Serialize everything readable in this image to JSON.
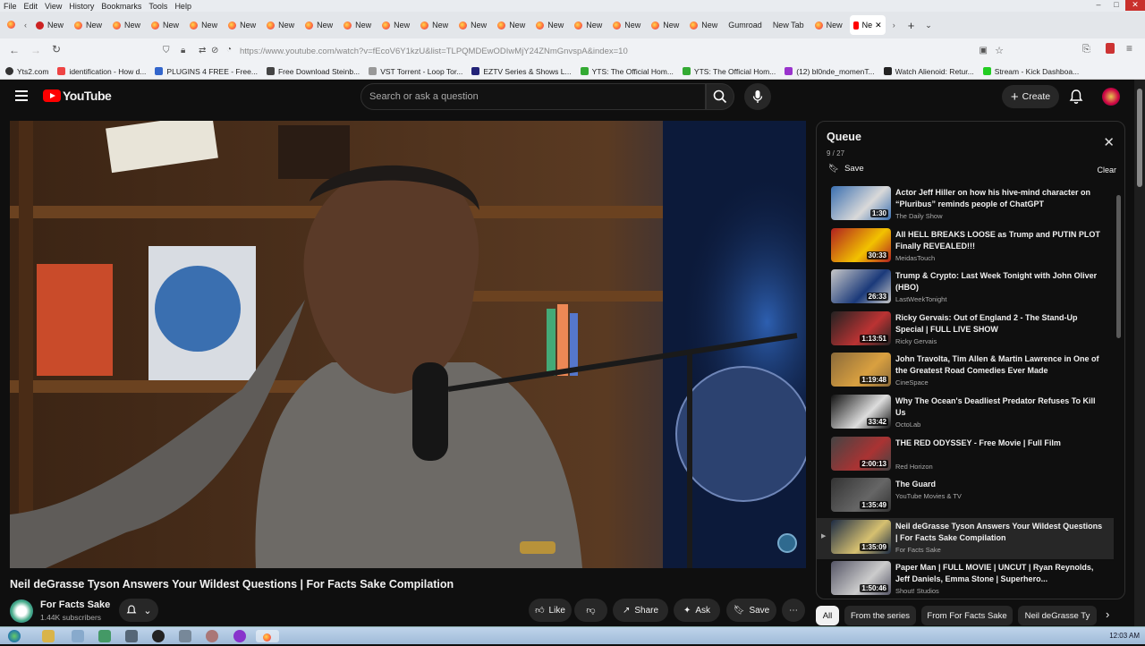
{
  "browser": {
    "menu": [
      "File",
      "Edit",
      "View",
      "History",
      "Bookmarks",
      "Tools",
      "Help"
    ],
    "tab_label": "New",
    "extra_tabs": [
      "Gumroad",
      "New Tab",
      "New"
    ],
    "active_tab_label": "Ne",
    "url": "https://www.youtube.com/watch?v=fEcoV6Y1kzU&list=TLPQMDEwODIwMjY24ZNmGnvspA&index=10",
    "bookmarks": [
      "Yts2.com",
      "identification - How d...",
      "PLUGINS 4 FREE - Free...",
      "Free Download Steinb...",
      "VST Torrent - Loop Tor...",
      "EZTV Series & Shows L...",
      "YTS: The Official Hom...",
      "YTS: The Official Hom...",
      "(12) bl0nde_momenT...",
      "Watch Alienoid: Retur...",
      "Stream - Kick Dashboa..."
    ]
  },
  "youtube": {
    "logo_text": "YouTube",
    "search_placeholder": "Search or ask a question",
    "create_label": "Create"
  },
  "video": {
    "title": "Neil deGrasse Tyson Answers Your Wildest Questions | For Facts Sake Compilation",
    "channel": "For Facts Sake",
    "subscribers": "1.44K subscribers",
    "actions": {
      "like": "Like",
      "share": "Share",
      "ask": "Ask",
      "save": "Save"
    }
  },
  "queue": {
    "title": "Queue",
    "count": "9 / 27",
    "save_label": "Save",
    "clear_label": "Clear",
    "items": [
      {
        "title": "Actor Jeff Hiller on how his hive-mind character on “Pluribus” reminds people of ChatGPT",
        "channel": "The Daily Show",
        "duration": "1:30"
      },
      {
        "title": "All HELL BREAKS LOOSE as Trump and PUTIN PLOT Finally REVEALED!!!",
        "channel": "MeidasTouch",
        "duration": "30:33"
      },
      {
        "title": "Trump & Crypto: Last Week Tonight with John Oliver (HBO)",
        "channel": "LastWeekTonight",
        "duration": "26:33"
      },
      {
        "title": "Ricky Gervais: Out of England 2 - The Stand-Up Special | FULL LIVE SHOW",
        "channel": "Ricky Gervais",
        "duration": "1:13:51"
      },
      {
        "title": "John Travolta, Tim Allen & Martin Lawrence in One of the Greatest Road Comedies Ever Made",
        "channel": "CineSpace",
        "duration": "1:19:48"
      },
      {
        "title": "Why The Ocean's Deadliest Predator Refuses To Kill Us",
        "channel": "OctoLab",
        "duration": "33:42"
      },
      {
        "title": "THE RED ODYSSEY - Free Movie | Full Film",
        "channel": "Red Horizon",
        "duration": "2:00:13"
      },
      {
        "title": "The Guard",
        "channel": "YouTube Movies & TV",
        "duration": "1:35:49"
      },
      {
        "title": "Neil deGrasse Tyson Answers Your Wildest Questions | For Facts Sake Compilation",
        "channel": "For Facts Sake",
        "duration": "1:35:09"
      },
      {
        "title": "Paper Man | FULL MOVIE | UNCUT | Ryan Reynolds, Jeff Daniels, Emma Stone | Superhero...",
        "channel": "Shout! Studios",
        "duration": "1:50:46"
      }
    ],
    "playing_marker": "▶"
  },
  "chips": [
    "All",
    "From the series",
    "From For Facts Sake",
    "Neil deGrasse Ty"
  ],
  "taskbar": {
    "clock": "12:03 AM"
  },
  "colors": {
    "accent": "#ff0000",
    "background": "#0f0f0f",
    "surface": "#272727"
  }
}
